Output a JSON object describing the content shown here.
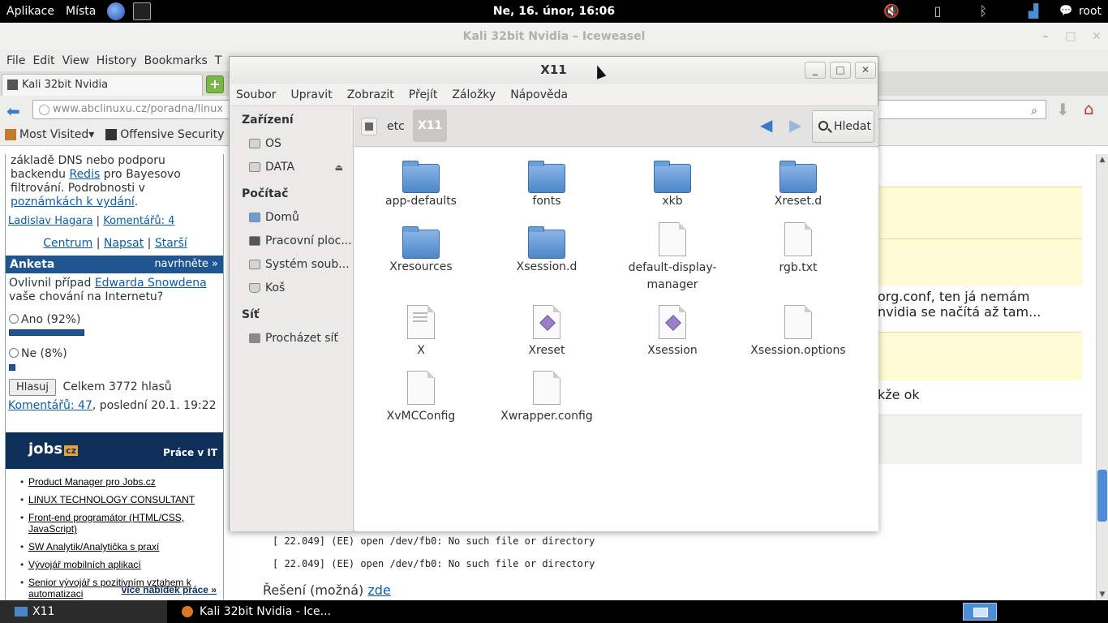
{
  "top_panel": {
    "apps_menu": "Aplikace",
    "places_menu": "Místa",
    "clock": "Ne, 16. únor, 16:06",
    "user": "root"
  },
  "browser": {
    "title": "Kali 32bit Nvidia – Iceweasel",
    "menu": [
      "File",
      "Edit",
      "View",
      "History",
      "Bookmarks",
      "T"
    ],
    "tab_title": "Kali 32bit Nvidia",
    "url": "www.abclinuxu.cz/poradna/linux",
    "bookmarks": [
      "Most Visited▾",
      "Offensive Security"
    ]
  },
  "page": {
    "article_lines": [
      "základě DNS nebo podporu",
      "backendu ",
      "Redis",
      " pro Bayesovo",
      "filtrování. Podrobnosti v",
      "poznámkách k vydání",
      "."
    ],
    "author": "Ladislav Hagara",
    "comments": "Komentářů: 4",
    "nav": [
      "Centrum",
      "Napsat",
      "Starší"
    ],
    "poll": {
      "heading": "Anketa",
      "suggest": "navrhněte »",
      "question_pre": "Ovlivnil případ ",
      "question_link": "Edwarda Snowdena",
      "question_post": "vaše chování na Internetu?",
      "yes": "Ano (92%)",
      "yes_fraction": 0.92,
      "no": "Ne (8%)",
      "no_fraction": 0.08,
      "vote_button": "Hlasuj",
      "total": "Celkem 3772 hlasů",
      "comments_link": "Komentářů: 47",
      "last": ", poslední 20.1. 19:22"
    },
    "jobs": {
      "logo": "jobs",
      "logo_suffix": "cz",
      "title": "Práce v IT",
      "items": [
        "Product Manager pro Jobs.cz",
        "LINUX TECHNOLOGY CONSULTANT",
        "Front-end programátor (HTML/CSS, JavaScript)",
        "SW Analytik/Analytička s praxí",
        "Vývojář mobilních aplikací",
        "Senior vývojář s pozitivním vztahem k automatizaci"
      ],
      "more": "více nabídek práce »"
    },
    "right_text_1": "org.conf, ten já nemám",
    "right_text_2": "nvidia se načítá až tam...",
    "right_text_3": "kže ok",
    "code_lines": [
      "[    22.049] (EE) open /dev/fb0: No such file or directory",
      "[    22.049] (EE) open /dev/fb0: No such file or directory"
    ],
    "solution_pre": "Řešení (možná) ",
    "solution_link": "zde"
  },
  "file_manager": {
    "title": "X11",
    "menu": [
      "Soubor",
      "Upravit",
      "Zobrazit",
      "Přejít",
      "Záložky",
      "Nápověda"
    ],
    "sidebar": {
      "devices_heading": "Zařízení",
      "devices": [
        "OS",
        "DATA"
      ],
      "computer_heading": "Počítač",
      "computer": [
        "Domů",
        "Pracovní ploc...",
        "Systém soub...",
        "Koš"
      ],
      "network_heading": "Síť",
      "network": [
        "Procházet síť"
      ]
    },
    "breadcrumb": [
      "etc",
      "X11"
    ],
    "search_button": "Hledat",
    "files": [
      {
        "name": "app-defaults",
        "type": "folder"
      },
      {
        "name": "fonts",
        "type": "folder"
      },
      {
        "name": "xkb",
        "type": "folder"
      },
      {
        "name": "Xreset.d",
        "type": "folder"
      },
      {
        "name": "Xresources",
        "type": "folder"
      },
      {
        "name": "Xsession.d",
        "type": "folder"
      },
      {
        "name": "default-display-manager",
        "type": "file"
      },
      {
        "name": "rgb.txt",
        "type": "file"
      },
      {
        "name": "X",
        "type": "exe"
      },
      {
        "name": "Xreset",
        "type": "script"
      },
      {
        "name": "Xsession",
        "type": "script"
      },
      {
        "name": "Xsession.options",
        "type": "file"
      },
      {
        "name": "XvMCConfig",
        "type": "file"
      },
      {
        "name": "Xwrapper.config",
        "type": "file"
      }
    ]
  },
  "taskbar": {
    "tasks": [
      "X11",
      "Kali 32bit Nvidia - Ice..."
    ]
  }
}
